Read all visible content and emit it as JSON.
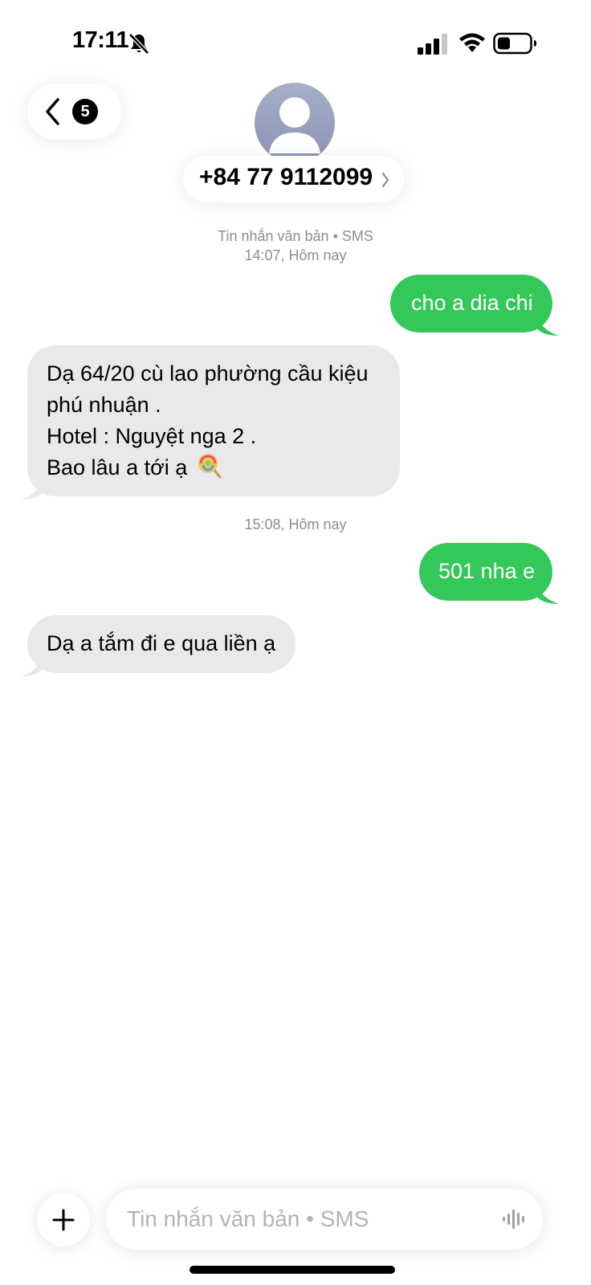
{
  "status_bar": {
    "time": "17:11",
    "icons": [
      "bell-slash-icon",
      "cellular-signal-icon",
      "wifi-icon",
      "battery-icon"
    ]
  },
  "header": {
    "unread_count": "5",
    "contact_name": "+84 77 9112099",
    "back_icon": "chevron-left-icon",
    "detail_icon": "chevron-right-icon",
    "avatar_icon": "person-silhouette-icon"
  },
  "conversation": {
    "service_label": "Tin nhắn văn bản • SMS",
    "timestamp_1": "14:07, Hôm nay",
    "timestamp_2": "15:08, Hôm nay",
    "messages": [
      {
        "direction": "sent",
        "text": "cho a dia chi"
      },
      {
        "direction": "received",
        "lines": [
          "Dạ 64/20 cù lao phường cầu kiệu",
          "phú nhuận .",
          "Hotel : Nguyệt nga 2 .",
          "Bao lâu a tới ạ"
        ],
        "emoji": "lollipop-icon"
      },
      {
        "direction": "sent",
        "text": "501 nha e"
      },
      {
        "direction": "received",
        "text": "Dạ a tắm đi e qua liền ạ"
      }
    ]
  },
  "composer": {
    "placeholder": "Tin nhắn văn bản • SMS",
    "value": "",
    "plus_icon": "plus-icon",
    "dictation_icon": "waveform-icon"
  },
  "colors": {
    "sent_bubble": "#34c759",
    "received_bubble": "#e9e9eb",
    "meta_text": "#8e8e93",
    "avatar": "#9aa2c0"
  }
}
